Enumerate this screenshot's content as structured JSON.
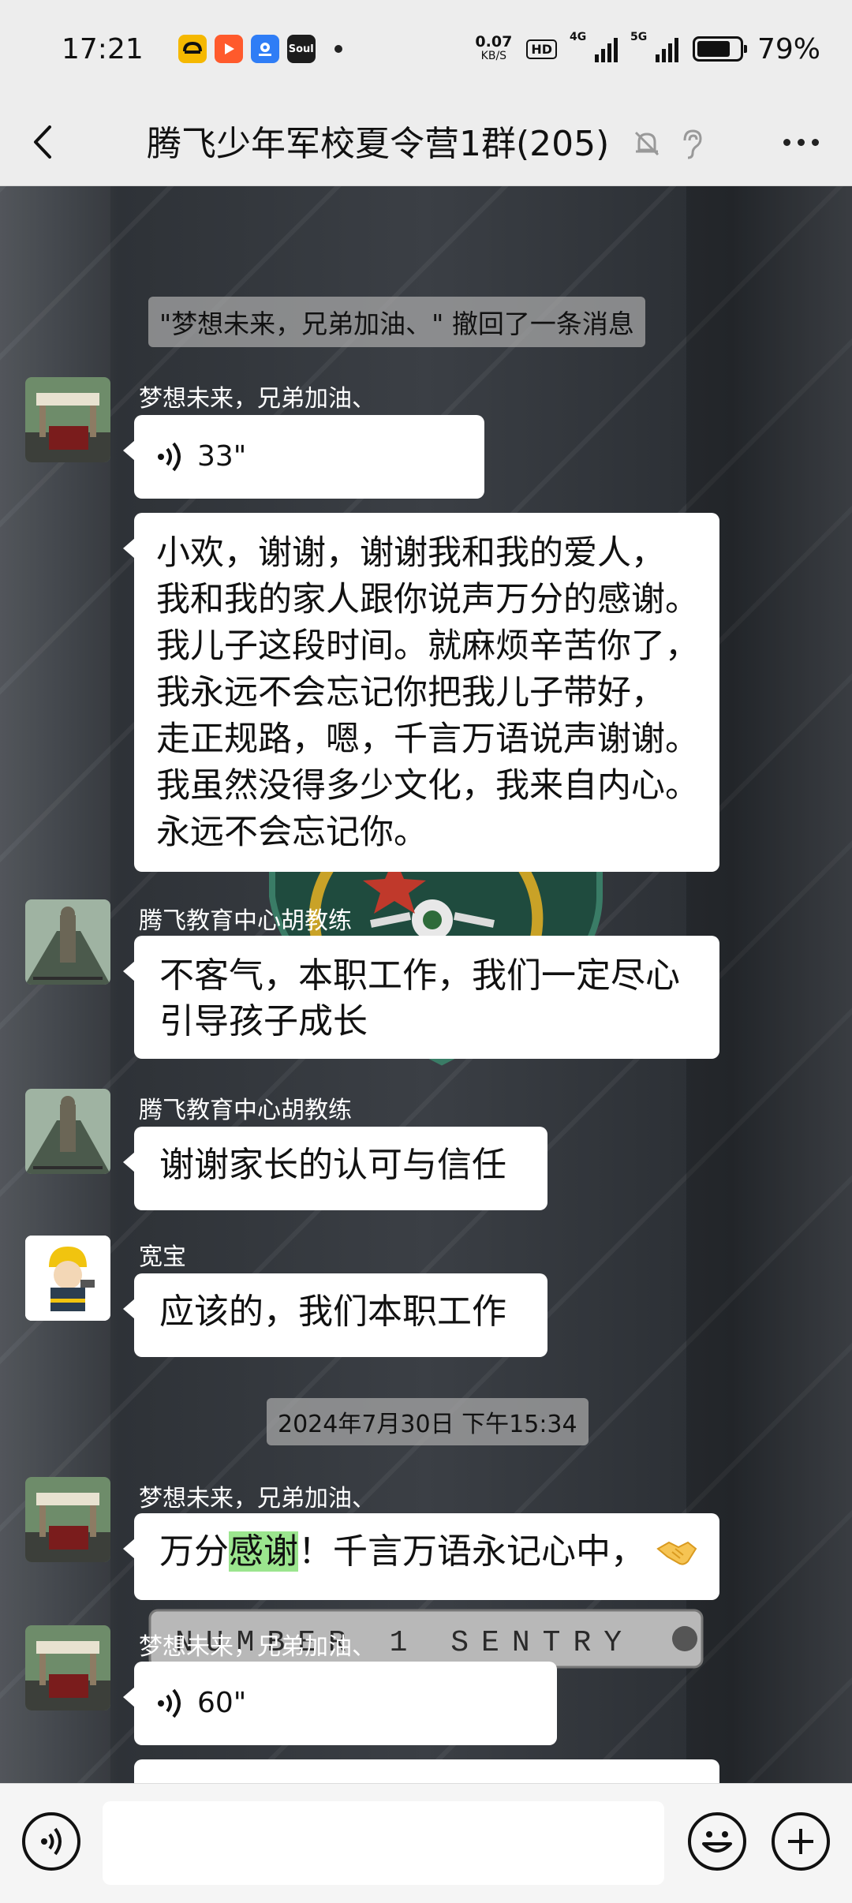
{
  "status_bar": {
    "time": "17:21",
    "net_speed_value": "0.07",
    "net_speed_unit": "KB/S",
    "hd_label": "HD",
    "signal1_label": "4G",
    "signal2_label": "5G",
    "battery_level": 0.79,
    "battery_percent": "79%",
    "app_icons": [
      {
        "name": "taxi-app-icon",
        "color": "#f5b800"
      },
      {
        "name": "video-app-icon",
        "color": "#ff5a2c"
      },
      {
        "name": "map-app-icon",
        "color": "#2f7df6"
      },
      {
        "name": "soul-app-icon",
        "label": "Soul",
        "color": "#1d1d1d"
      }
    ]
  },
  "nav": {
    "title": "腾飞少年军校夏令营1群(205)",
    "icons": [
      "back-arrow-icon",
      "mute-bell-icon",
      "ear-icon",
      "more-dots-icon"
    ]
  },
  "chat": {
    "recall_notice": "\"梦想未来，兄弟加油、\" 撤回了一条消息",
    "messages": [
      {
        "sender": "梦想未来，兄弟加油、",
        "voice_duration": "33\""
      },
      {
        "text_lines": [
          "小欢，谢谢，谢谢我和我的爱人，",
          "我和我的家人跟你说声万分的感谢。",
          "我儿子这段时间。就麻烦辛苦你了，",
          "我永远不会忘记你把我儿子带好，",
          "走正规路，嗯，千言万语说声谢谢。",
          "我虽然没得多少文化，我来自内心。",
          "永远不会忘记你。"
        ]
      },
      {
        "sender": "腾飞教育中心胡教练",
        "text_lines": [
          "不客气，本职工作，我们一定尽心",
          "引导孩子成长"
        ]
      },
      {
        "sender": "腾飞教育中心胡教练",
        "text": "谢谢家长的认可与信任"
      },
      {
        "sender": "宽宝",
        "text": "应该的，我们本职工作"
      },
      {
        "sender": "梦想未来，兄弟加油、",
        "text_before": "万分",
        "text_highlight": "感谢",
        "text_after": "！千言万语永记心中，",
        "emoji": "handshake-emoji"
      },
      {
        "sender": "梦想未来，兄弟加油、",
        "voice_duration": "60\""
      }
    ],
    "timestamp": "2024年7月30日 下午15:34",
    "background_sign_text": "NUMBER 1 SENTRY"
  },
  "input_bar": {
    "placeholder": "",
    "icons": [
      "voice-input-icon",
      "emoji-icon",
      "plus-icon"
    ]
  }
}
